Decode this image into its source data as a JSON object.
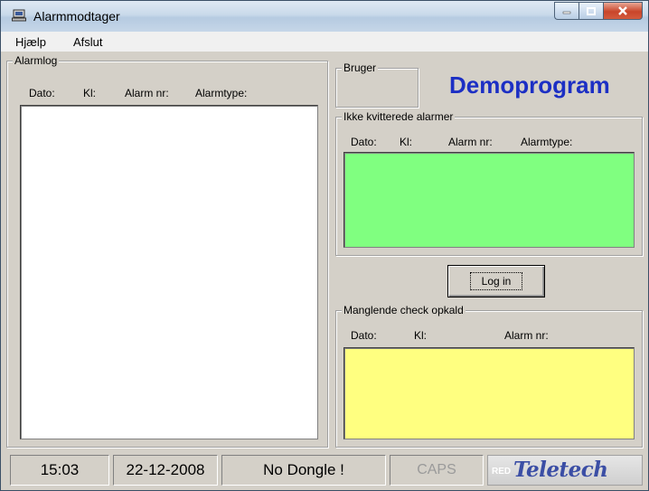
{
  "window": {
    "title": "Alarmmodtager"
  },
  "menu": {
    "items": [
      "Hjælp",
      "Afslut"
    ]
  },
  "alarmlog": {
    "legend": "Alarmlog",
    "columns": [
      "Dato:",
      "Kl:",
      "Alarm nr:",
      "Alarmtype:"
    ]
  },
  "bruger": {
    "legend": "Bruger"
  },
  "brand": {
    "title": "Demoprogram",
    "color": "#1c2fc4"
  },
  "unack": {
    "legend": "Ikke kvitterede alarmer",
    "columns": [
      "Dato:",
      "Kl:",
      "Alarm nr:",
      "Alarmtype:"
    ],
    "color": "#80ff80"
  },
  "login": {
    "label": "Log in"
  },
  "missing": {
    "legend": "Manglende check opkald",
    "columns": [
      "Dato:",
      "Kl:",
      "Alarm nr:"
    ],
    "color": "#ffff80"
  },
  "statusbar": {
    "time": "15:03",
    "date": "22-12-2008",
    "dongle": "No Dongle !",
    "caps": "CAPS",
    "logo_text": "Teletech a/s",
    "logo_prefix": "RED"
  }
}
